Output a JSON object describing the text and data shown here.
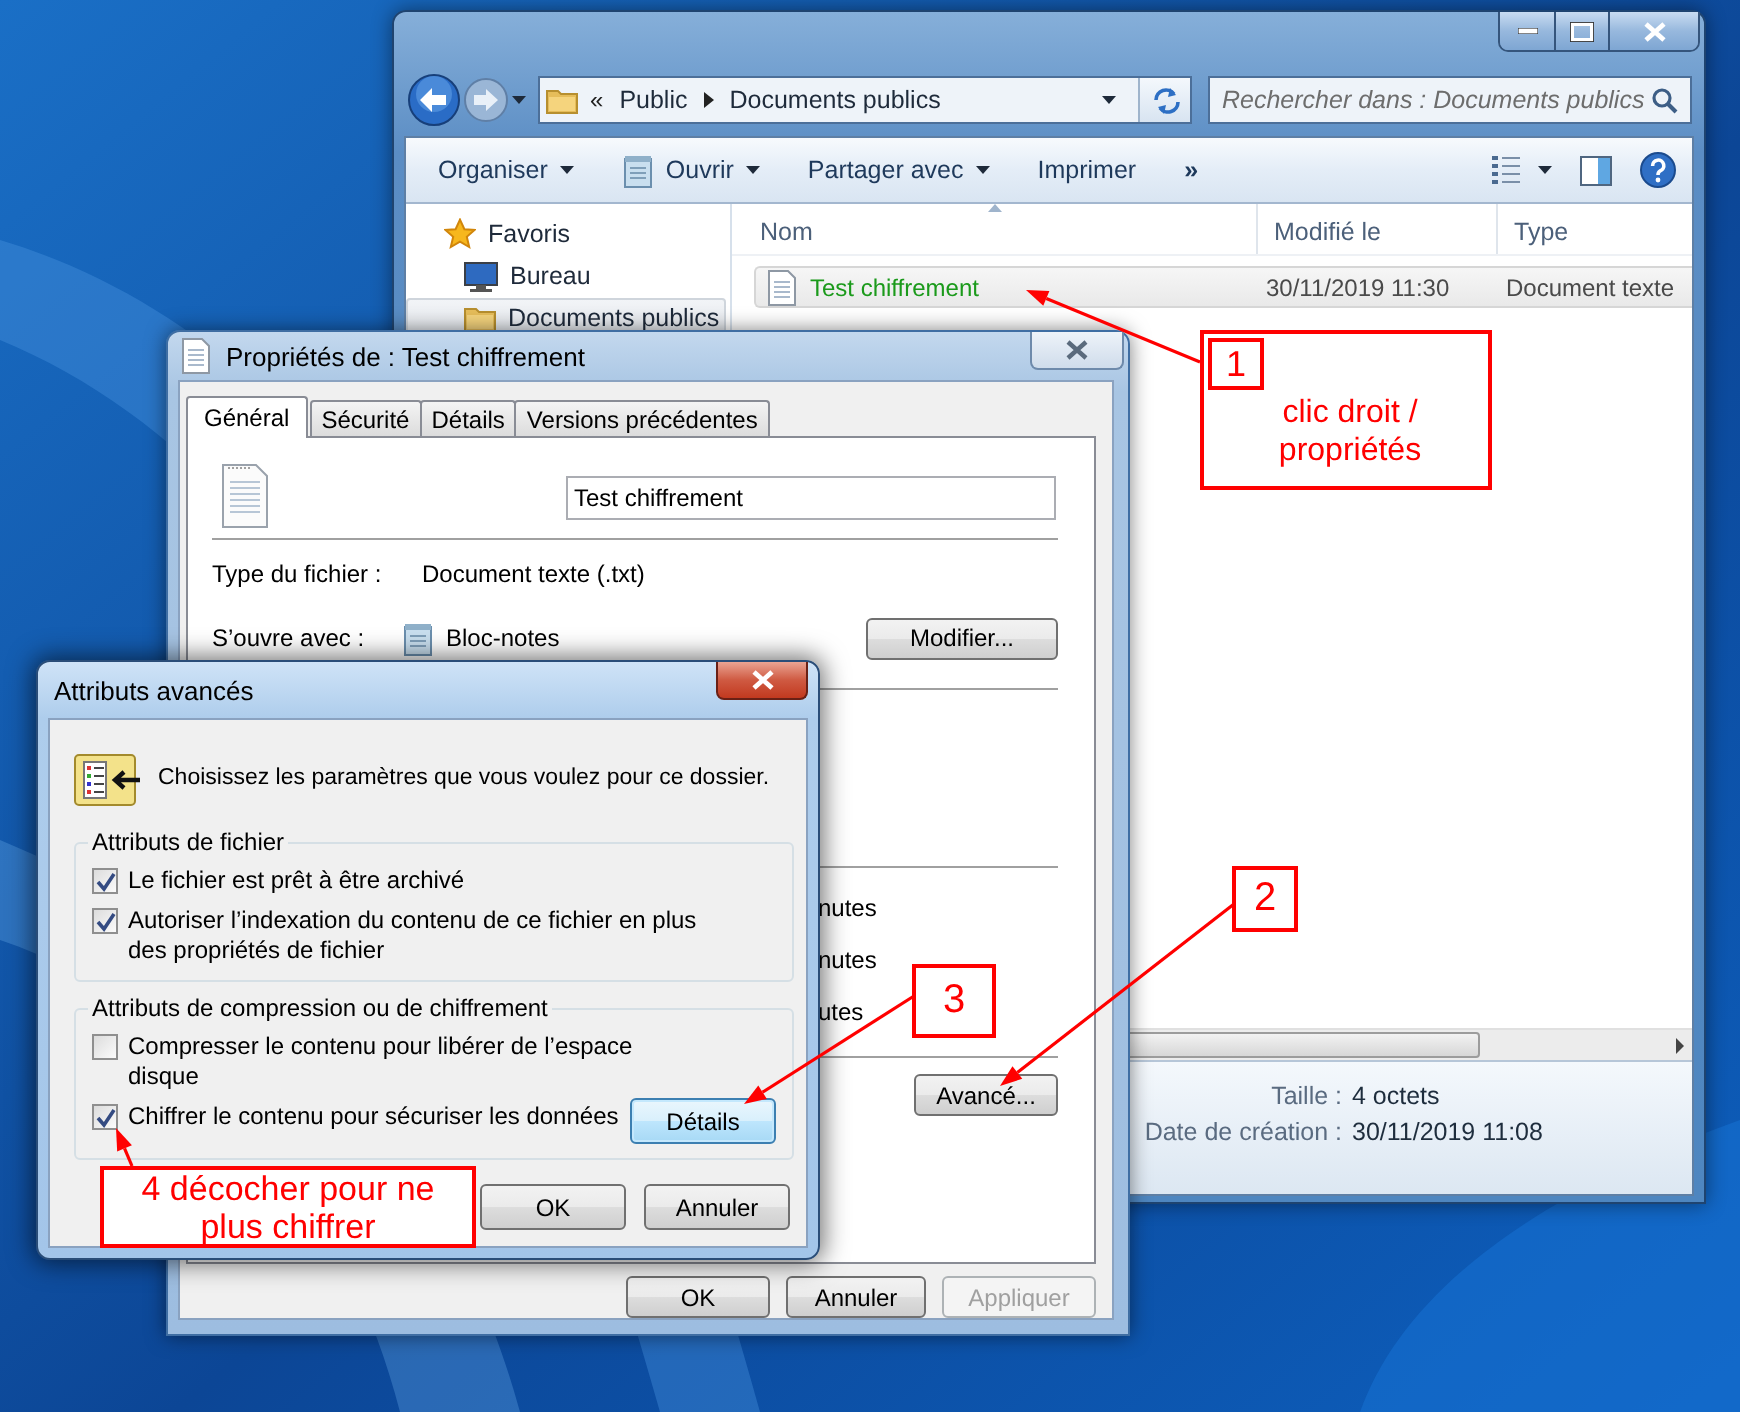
{
  "explorer": {
    "address": {
      "prefix": "«",
      "path": [
        "Public",
        "Documents publics"
      ]
    },
    "search": {
      "placeholder": "Rechercher dans : Documents publics"
    },
    "toolbar": [
      {
        "label": "Organiser",
        "kind": "menu"
      },
      {
        "label": "Ouvrir",
        "kind": "app-menu"
      },
      {
        "label": "Partager avec",
        "kind": "menu"
      },
      {
        "label": "Imprimer",
        "kind": "button"
      },
      {
        "label": "»",
        "kind": "overflow"
      }
    ],
    "sidebar": {
      "items": [
        {
          "label": "Favoris",
          "kind": "favorites",
          "selected": false
        },
        {
          "label": "Bureau",
          "kind": "desktop",
          "selected": false
        },
        {
          "label": "Documents publics",
          "kind": "folder",
          "selected": true
        }
      ]
    },
    "table": {
      "columns": [
        {
          "label": "Nom",
          "sorted": true
        },
        {
          "label": "Modifié le",
          "sorted": false
        },
        {
          "label": "Type",
          "sorted": false
        }
      ],
      "rows": [
        {
          "name": "Test chiffrement",
          "modified": "30/11/2019 11:30",
          "type": "Document texte",
          "selected": true,
          "encrypted": true
        }
      ]
    },
    "details": [
      {
        "label": "Taille :",
        "value": "4 octets"
      },
      {
        "label": "Date de création :",
        "value": "30/11/2019 11:08"
      }
    ]
  },
  "properties": {
    "title": "Propriétés de : Test chiffrement",
    "tabs": [
      {
        "label": "Général",
        "selected": true
      },
      {
        "label": "Sécurité",
        "selected": false
      },
      {
        "label": "Détails",
        "selected": false
      },
      {
        "label": "Versions précédentes",
        "selected": false
      }
    ],
    "file_name": "Test chiffrement",
    "fields": [
      {
        "label": "Type du fichier :",
        "value": "Document texte (.txt)",
        "kind": "text"
      },
      {
        "label": "S’ouvre avec :",
        "value": "Bloc-notes",
        "kind": "app",
        "button": "Modifier..."
      }
    ],
    "partial_lines": [
      "nutes",
      "nutes",
      "utes"
    ],
    "advanced_button": "Avancé...",
    "buttons": [
      {
        "label": "OK",
        "disabled": false
      },
      {
        "label": "Annuler",
        "disabled": false
      },
      {
        "label": "Appliquer",
        "disabled": true
      }
    ]
  },
  "advanced_attributes": {
    "title": "Attributs avancés",
    "intro": "Choisissez les paramètres que vous voulez pour ce dossier.",
    "groups": [
      {
        "legend": "Attributs de fichier",
        "options": [
          {
            "label": "Le fichier est prêt à être archivé",
            "checked": true
          },
          {
            "label": "Autoriser l’indexation du contenu de ce fichier en plus des propriétés de fichier",
            "checked": true
          }
        ]
      },
      {
        "legend": "Attributs de compression ou de chiffrement",
        "options": [
          {
            "label": "Compresser le contenu pour libérer de l’espace disque",
            "checked": false
          },
          {
            "label": "Chiffrer le contenu pour sécuriser les données",
            "checked": true
          }
        ],
        "button": "Détails"
      }
    ],
    "buttons": [
      "OK",
      "Annuler"
    ]
  },
  "annotations": [
    {
      "kind": "numbered-note",
      "number": "1",
      "text": "clic droit / propriétés"
    },
    {
      "kind": "number",
      "number": "2"
    },
    {
      "kind": "number",
      "number": "3"
    },
    {
      "kind": "note",
      "text": "4 décocher pour ne plus chiffrer"
    }
  ]
}
